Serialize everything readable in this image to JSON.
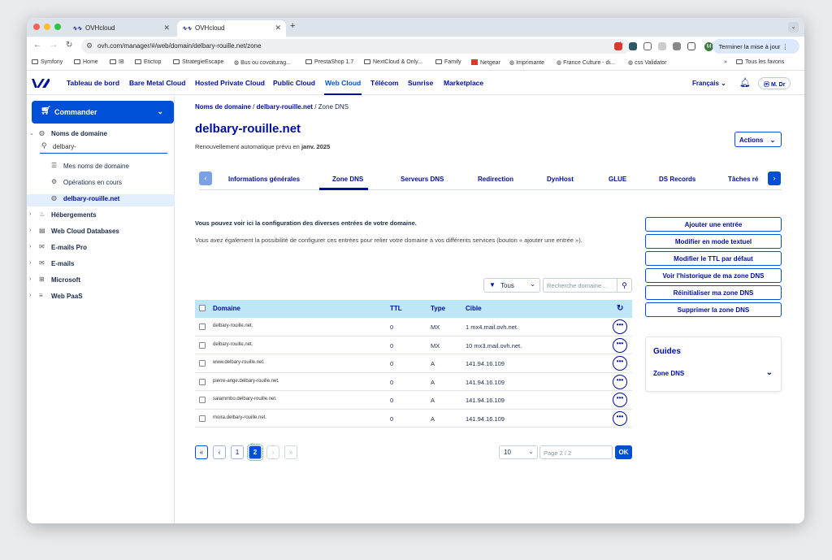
{
  "browser": {
    "tabs": [
      {
        "title": "OVHcloud"
      },
      {
        "title": "OVHcloud"
      }
    ],
    "url": "ovh.com/manager/#/web/domain/delbary-rouille.net/zone",
    "update_button": "Terminer la mise à jour",
    "bookmarks": [
      "Symfony",
      "Home",
      "IB",
      "Etictop",
      "StrategieEscape",
      "Bus ou covoiturag...",
      "PrestaShop 1.7",
      "NextCloud & Only...",
      "Family",
      "Netgear",
      "Imprimante",
      "France Culture - di...",
      "css Validator"
    ],
    "all_bookmarks": "Tous les favoris",
    "profile_initial": "M"
  },
  "topnav": {
    "items": [
      "Tableau de bord",
      "Bare Metal Cloud",
      "Hosted Private Cloud",
      "Public Cloud",
      "Web Cloud",
      "Télécom",
      "Sunrise",
      "Marketplace"
    ],
    "active": "Web Cloud",
    "language": "Français",
    "user": "M. Dr"
  },
  "sidebar": {
    "commander": "Commander",
    "section": "Noms de domaine",
    "search_value": "delbary-",
    "sub_items": [
      "Mes noms de domaine",
      "Opérations en cours",
      "delbary-rouille.net"
    ],
    "items": [
      "Hébergements",
      "Web Cloud Databases",
      "E-mails Pro",
      "E-mails",
      "Microsoft",
      "Web PaaS"
    ]
  },
  "breadcrumb": {
    "part1": "Noms de domaine",
    "sep": "/",
    "part2": "delbary-rouille.net",
    "part3": "Zone DNS"
  },
  "page": {
    "title": "delbary-rouille.net",
    "renewal_prefix": "Renouvellement automatique prévu en",
    "renewal_date": "janv. 2025",
    "actions": "Actions"
  },
  "tabs": [
    "Informations générales",
    "Zone DNS",
    "Serveurs DNS",
    "Redirection",
    "DynHost",
    "GLUE",
    "DS Records",
    "Tâches ré"
  ],
  "description": {
    "line1": "Vous pouvez voir ici la configuration des diverses entrées de votre domaine.",
    "line2": "Vous avez également la possibilité de configurer ces entrées pour relier votre domaine à vos différents services (bouton « ajouter une entrée »)."
  },
  "side_buttons": [
    "Ajouter une entrée",
    "Modifier en mode textuel",
    "Modifier le TTL par défaut",
    "Voir l'historique de ma zone DNS",
    "Réinitialiser ma zone DNS",
    "Supprimer la zone DNS"
  ],
  "filter": {
    "value": "Tous",
    "search_placeholder": "Recherche domaine..."
  },
  "table": {
    "headers": {
      "domain": "Domaine",
      "ttl": "TTL",
      "type": "Type",
      "target": "Cible"
    },
    "rows": [
      {
        "domain": "delbary-rouille.net.",
        "ttl": "0",
        "type": "MX",
        "target": "1 mx4.mail.ovh.net."
      },
      {
        "domain": "delbary-rouille.net.",
        "ttl": "0",
        "type": "MX",
        "target": "10 mx3.mail.ovh.net."
      },
      {
        "domain": "www.delbary-rouille.net.",
        "ttl": "0",
        "type": "A",
        "target": "141.94.16.109"
      },
      {
        "domain": "pierre-ange.delbary-rouille.net.",
        "ttl": "0",
        "type": "A",
        "target": "141.94.16.109"
      },
      {
        "domain": "salammbo.delbary-rouille.net.",
        "ttl": "0",
        "type": "A",
        "target": "141.94.16.109"
      },
      {
        "domain": "moira.delbary-rouille.net.",
        "ttl": "0",
        "type": "A",
        "target": "141.94.16.109"
      }
    ]
  },
  "pagination": {
    "pages": [
      "1",
      "2"
    ],
    "current": "2",
    "per_page": "10",
    "page_placeholder": "Page 2 / 2",
    "ok": "OK"
  },
  "guides": {
    "title": "Guides",
    "item": "Zone DNS"
  },
  "colors": {
    "primary": "#000e9c",
    "accent": "#0050d7",
    "table_header": "#bde6f7"
  }
}
